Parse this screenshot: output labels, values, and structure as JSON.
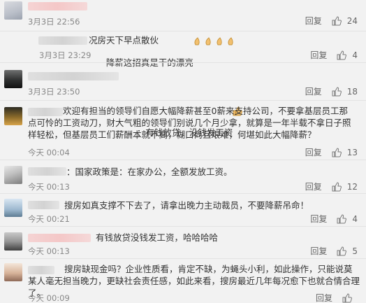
{
  "comments": [
    {
      "text": "降薪这招真是干的漂亮",
      "time": "3月3日 22:56",
      "reply": "回复",
      "likes": "24"
    },
    {
      "text": "况房天下早点散伙",
      "time": "3月3日 23:29",
      "reply": "回复",
      "likes": "4"
    },
    {
      "text": "：有钱放贷，没钱发工资",
      "time": "3月3日 23:50",
      "reply": "回复",
      "likes": "18"
    },
    {
      "text": "欢迎有担当的领导们自愿大幅降薪甚至0薪来支持公司，不要拿基层员工那点可怜的工资动刀，财大气粗的领导们别说几个月少拿，就算是一年半载不拿日子照样轻松，但基层员工们薪酬本就不高，糊口尚且艰难，何堪如此大幅降薪？",
      "time": "今天 00:04",
      "reply": "回复",
      "likes": "13"
    },
    {
      "text": "：国家政策是：在家办公，全额发放工资。",
      "time": "今天 00:13",
      "reply": "回复",
      "likes": "12"
    },
    {
      "text": "搜房如真支撑不下去了，请拿出晚力主动裁员，不要降薪吊命！",
      "time": "今天 00:21",
      "reply": "回复",
      "likes": "4"
    },
    {
      "text": "有钱放贷没钱发工资，哈哈哈哈",
      "time": "今天 00:13",
      "reply": "回复",
      "likes": "5"
    },
    {
      "text": "搜房缺现金吗？企业性质看，肯定不缺，为蝇头小利，如此操作，只能说莫某人毫无担当晚力，更缺社会责任感，如此来看，搜房最近几年每况愈下也就合情合理了。",
      "time": "今天 00:09",
      "reply": "回复",
      "likes": ""
    }
  ]
}
